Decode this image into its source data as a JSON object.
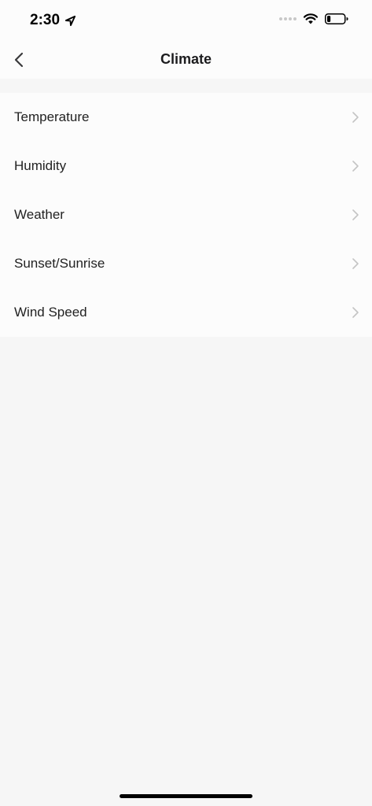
{
  "status_bar": {
    "time": "2:30",
    "battery_level": 0.2
  },
  "nav": {
    "title": "Climate"
  },
  "list": {
    "items": [
      {
        "label": "Temperature"
      },
      {
        "label": "Humidity"
      },
      {
        "label": "Weather"
      },
      {
        "label": "Sunset/Sunrise"
      },
      {
        "label": "Wind Speed"
      }
    ]
  },
  "icons": {
    "back": "chevron-left-icon",
    "row": "chevron-right-icon",
    "location": "location-arrow-icon",
    "wifi": "wifi-icon",
    "battery": "battery-icon"
  },
  "colors": {
    "background": "#f6f6f6",
    "surface": "#fcfcfc",
    "chevron": "#c4c4c4"
  }
}
